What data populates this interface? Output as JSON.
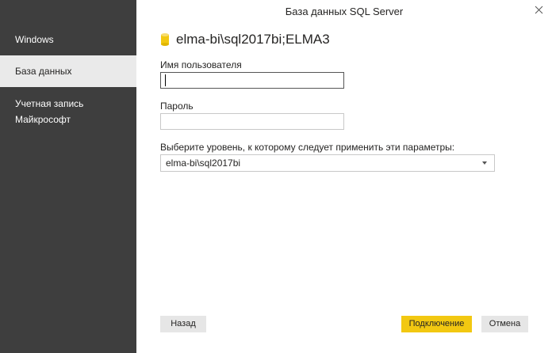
{
  "dialog": {
    "title": "База данных SQL Server",
    "close_icon": "close-icon"
  },
  "sidebar": {
    "items": [
      {
        "label": "Windows",
        "active": false
      },
      {
        "label": "База данных",
        "active": true
      },
      {
        "label": "Учетная запись Майкрософт",
        "active": false
      }
    ]
  },
  "main": {
    "db_icon": "database-icon",
    "db_icon_color": "#f2c811",
    "database_name": "elma-bi\\sql2017bi;ELMA3",
    "username": {
      "label": "Имя пользователя",
      "value": ""
    },
    "password": {
      "label": "Пароль",
      "value": ""
    },
    "level": {
      "label": "Выберите уровень, к которому следует применить эти параметры:",
      "selected": "elma-bi\\sql2017bi"
    }
  },
  "footer": {
    "back_label": "Назад",
    "connect_label": "Подключение",
    "cancel_label": "Отмена",
    "accent_color": "#f2c811"
  }
}
